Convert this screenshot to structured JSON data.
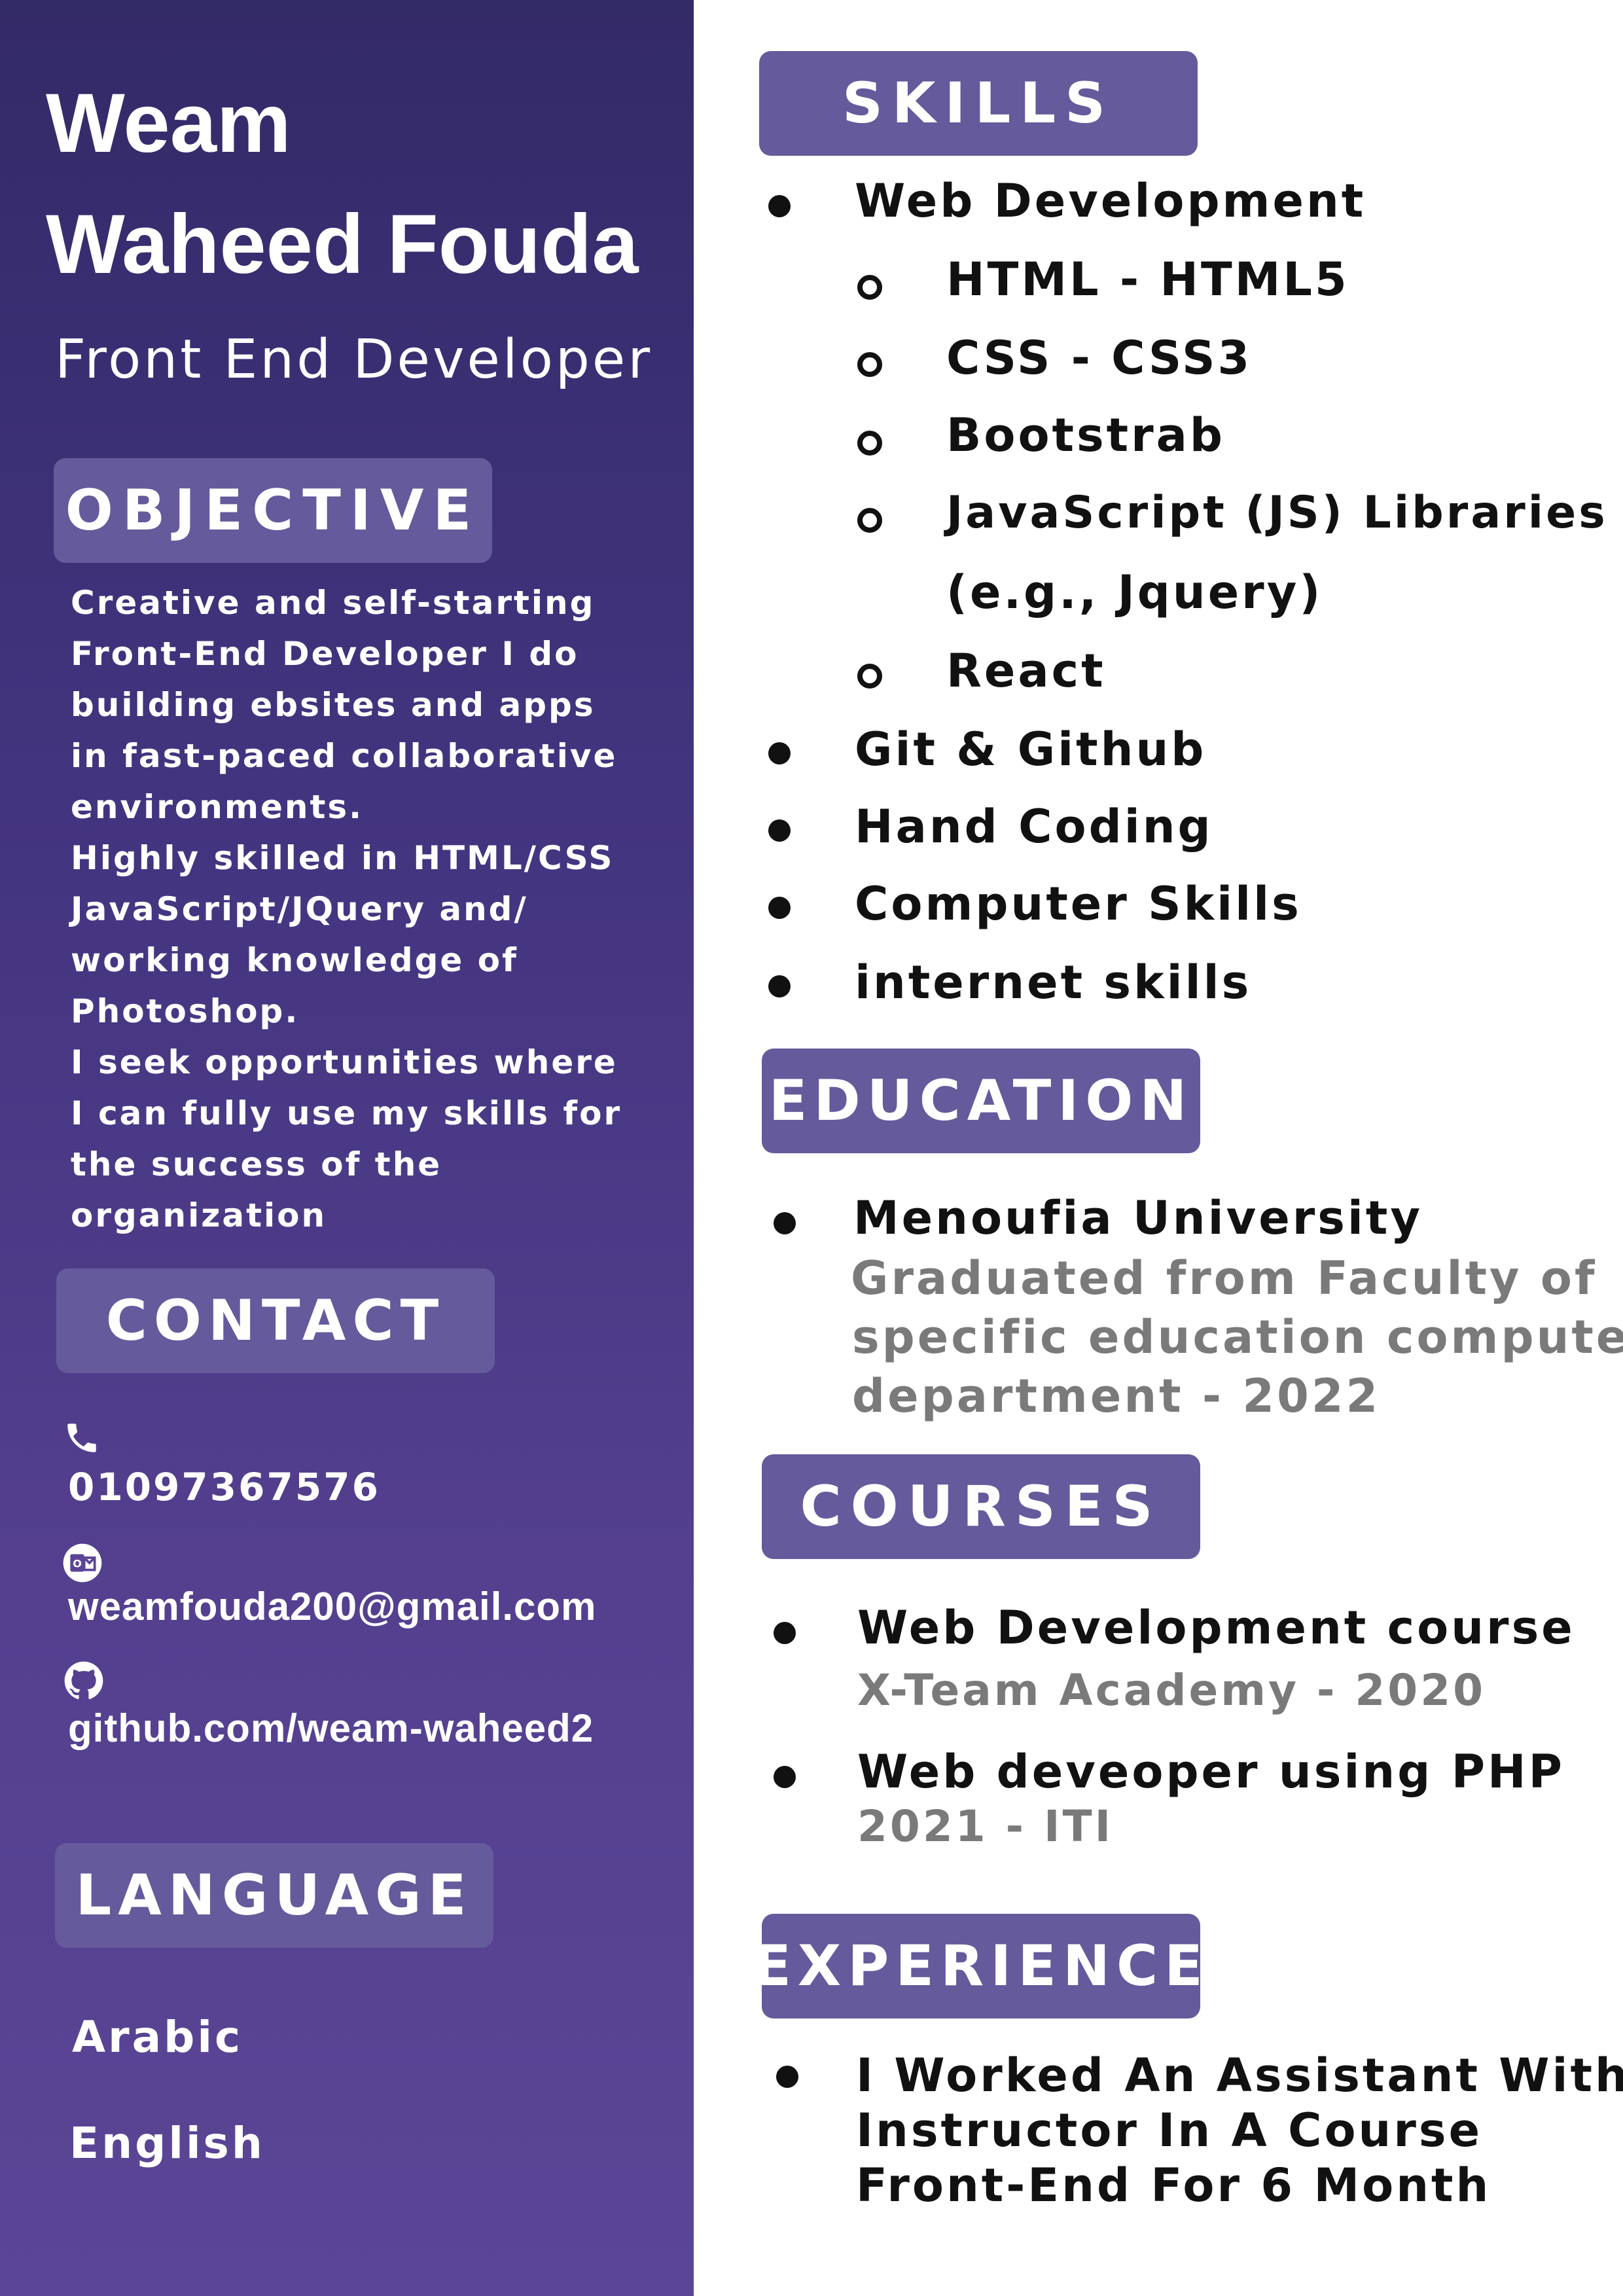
{
  "header": {
    "first_name": "Weam",
    "last_name": "Waheed Fouda",
    "role": "Front End Developer"
  },
  "objective": {
    "title": "OBJECTIVE",
    "lines": [
      "Creative and self-starting",
      "Front-End Developer I do",
      "building ebsites and apps",
      "in fast-paced collaborative",
      "environments.",
      "Highly skilled in HTML/CSS",
      "JavaScript/JQuery and/",
      "working knowledge of",
      "Photoshop.",
      "I seek opportunities where",
      "I can fully use my skills for",
      "the success of the organization"
    ]
  },
  "contact": {
    "title": "CONTACT",
    "phone": "01097367576",
    "email": "weamfouda200@gmail.com",
    "github": "github.com/weam-waheed2",
    "icons": [
      "phone-icon",
      "outlook-icon",
      "github-icon"
    ]
  },
  "language": {
    "title": "LANGUAGE",
    "items": [
      "Arabic",
      "English"
    ]
  },
  "skills": {
    "title": "SKILLS",
    "web": "Web Development",
    "web_sub": [
      "HTML  - HTML5",
      "CSS  - CSS3",
      "Bootstrab",
      "JavaScript (JS) Libraries",
      "(e.g., Jquery)",
      "React"
    ],
    "other": [
      "Git & Github",
      "Hand Coding",
      "Computer Skills",
      "internet skills"
    ]
  },
  "education": {
    "title": "EDUCATION",
    "school": "Menoufia University",
    "lines": [
      "Graduated  from  Faculty of",
      "specific education computer",
      "department - 2022"
    ]
  },
  "courses": {
    "title": "COURSES",
    "items": [
      {
        "name": "Web Development course",
        "detail": "X-Team Academy - 2020"
      },
      {
        "name": "Web deveoper using PHP",
        "detail": "2021  - ITI"
      }
    ]
  },
  "experience": {
    "title": "EXPERIENCE",
    "lines": [
      "I Worked An Assistant With",
      "Instructor In A Course",
      "Front-End For 6 Month"
    ]
  },
  "colors": {
    "sidebar_top": "#332a68",
    "sidebar_bottom": "#5b4596",
    "pill": "#655a9c",
    "subtext": "#7a7a7a"
  }
}
